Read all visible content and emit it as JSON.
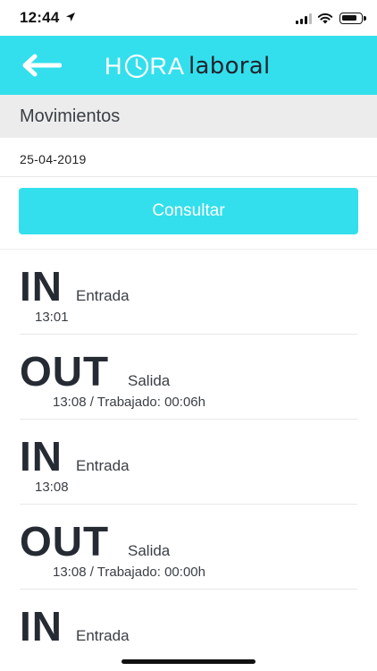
{
  "status_bar": {
    "time": "12:44",
    "icons": [
      "location-arrow-icon",
      "cellular-signal-icon",
      "wifi-icon",
      "battery-icon"
    ]
  },
  "header": {
    "back_icon": "arrow-left-icon",
    "logo_hora_prefix": "H",
    "logo_hora_suffix": "RA",
    "logo_laboral": "laboral"
  },
  "section": {
    "title": "Movimientos"
  },
  "filter": {
    "date": "25-04-2019",
    "submit_label": "Consultar"
  },
  "movements": [
    {
      "type": "IN",
      "label": "Entrada",
      "detail": "13:01"
    },
    {
      "type": "OUT",
      "label": "Salida",
      "detail": "13:08 / Trabajado: 00:06h"
    },
    {
      "type": "IN",
      "label": "Entrada",
      "detail": "13:08"
    },
    {
      "type": "OUT",
      "label": "Salida",
      "detail": "13:08 / Trabajado: 00:00h"
    },
    {
      "type": "IN",
      "label": "Entrada",
      "detail": ""
    }
  ],
  "colors": {
    "accent": "#33dfec",
    "text_dark": "#262b33",
    "section_bg": "#ececec"
  }
}
